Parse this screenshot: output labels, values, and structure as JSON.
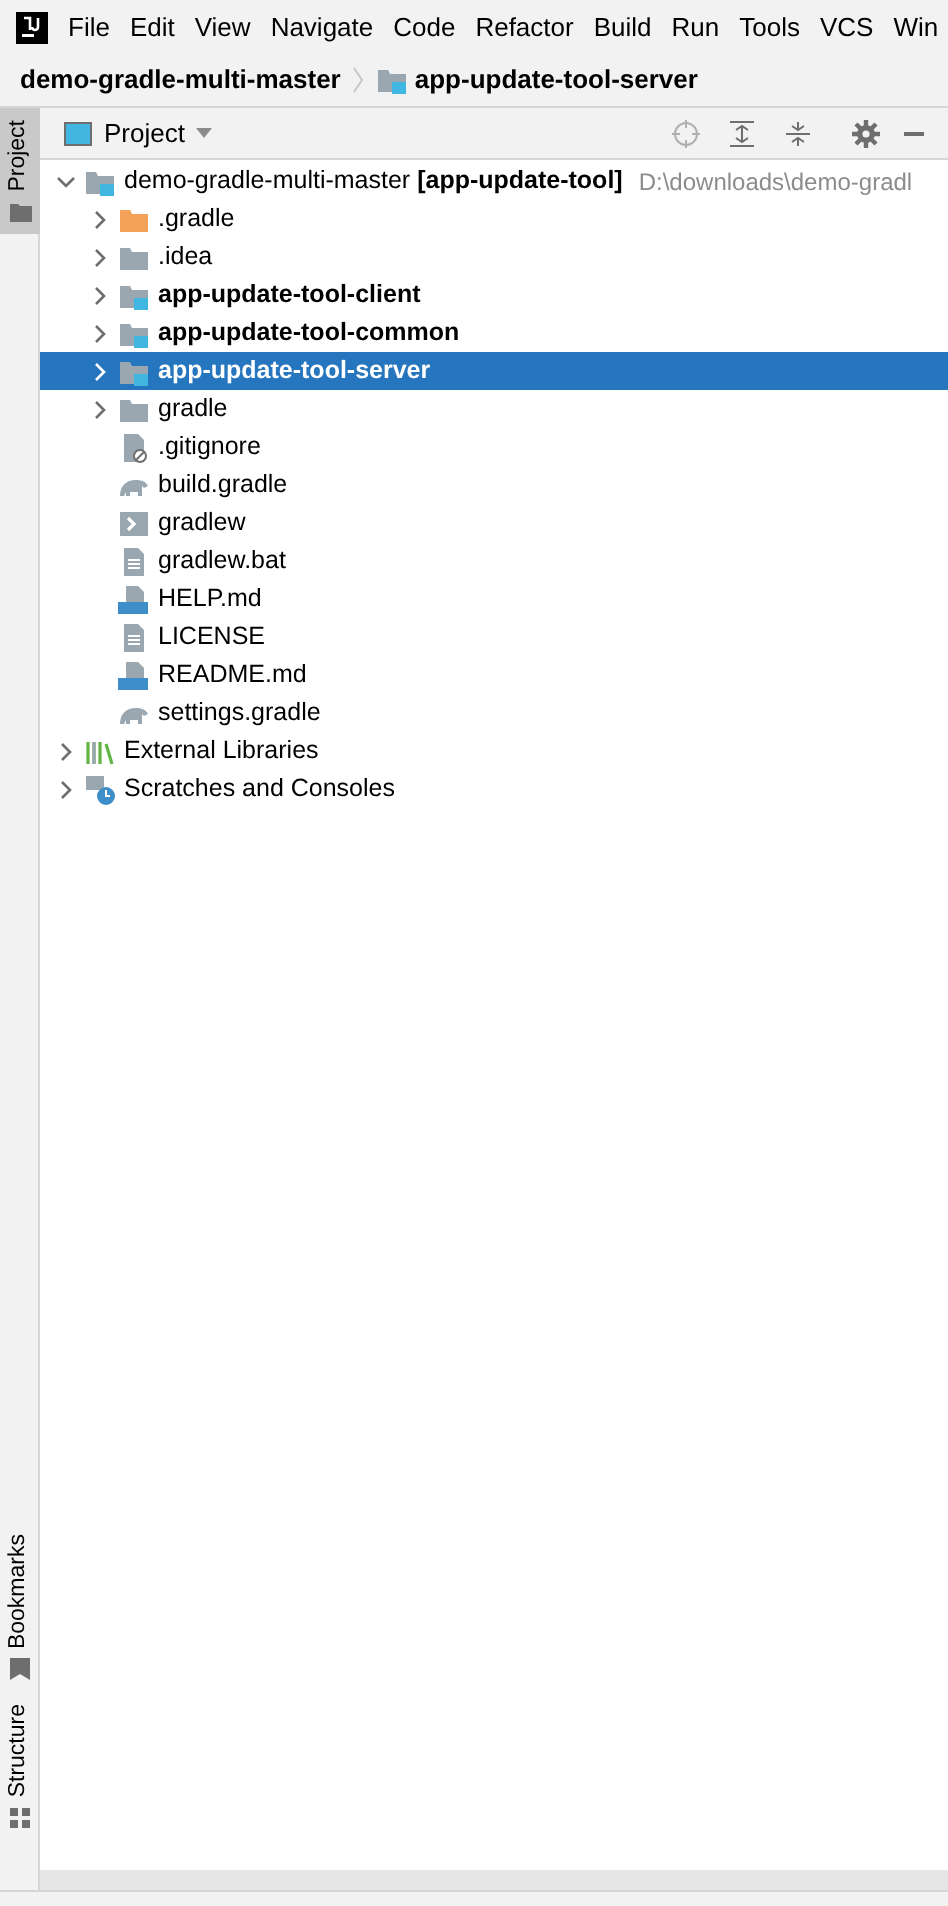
{
  "menu": [
    "File",
    "Edit",
    "View",
    "Navigate",
    "Code",
    "Refactor",
    "Build",
    "Run",
    "Tools",
    "VCS",
    "Win"
  ],
  "breadcrumb": [
    {
      "label": "demo-gradle-multi-master",
      "kind": "project"
    },
    {
      "label": "app-update-tool-server",
      "kind": "module"
    }
  ],
  "side_tabs": [
    {
      "label": "Project",
      "selected": true,
      "kind": "project"
    },
    {
      "label": "Bookmarks",
      "selected": false,
      "kind": "bookmarks"
    },
    {
      "label": "Structure",
      "selected": false,
      "kind": "structure"
    }
  ],
  "panel": {
    "title": "Project"
  },
  "tree": [
    {
      "label": "demo-gradle-multi-master **[app-update-tool]**",
      "path": "D:\\downloads\\demo-gradl",
      "kind": "module",
      "expanded": true,
      "selected": false,
      "children": [
        {
          "label": ".gradle",
          "kind": "folder-excluded",
          "expanded": false,
          "selected": false
        },
        {
          "label": ".idea",
          "kind": "folder",
          "expanded": false,
          "selected": false
        },
        {
          "label": "app-update-tool-client",
          "kind": "module",
          "bold": true,
          "expanded": false,
          "selected": false
        },
        {
          "label": "app-update-tool-common",
          "kind": "module",
          "bold": true,
          "expanded": false,
          "selected": false
        },
        {
          "label": "app-update-tool-server",
          "kind": "module",
          "bold": true,
          "expanded": false,
          "selected": true
        },
        {
          "label": "gradle",
          "kind": "folder",
          "expanded": false,
          "selected": false
        },
        {
          "label": ".gitignore",
          "kind": "ignore",
          "selected": false
        },
        {
          "label": "build.gradle",
          "kind": "gradle",
          "selected": false
        },
        {
          "label": "gradlew",
          "kind": "script",
          "selected": false
        },
        {
          "label": "gradlew.bat",
          "kind": "text",
          "selected": false
        },
        {
          "label": "HELP.md",
          "kind": "markdown",
          "selected": false
        },
        {
          "label": "LICENSE",
          "kind": "text",
          "selected": false
        },
        {
          "label": "README.md",
          "kind": "markdown",
          "selected": false
        },
        {
          "label": "settings.gradle",
          "kind": "gradle",
          "selected": false
        }
      ]
    },
    {
      "label": "External Libraries",
      "kind": "libraries",
      "expanded": false,
      "selected": false
    },
    {
      "label": "Scratches and Consoles",
      "kind": "scratches",
      "expanded": false,
      "selected": false
    }
  ]
}
